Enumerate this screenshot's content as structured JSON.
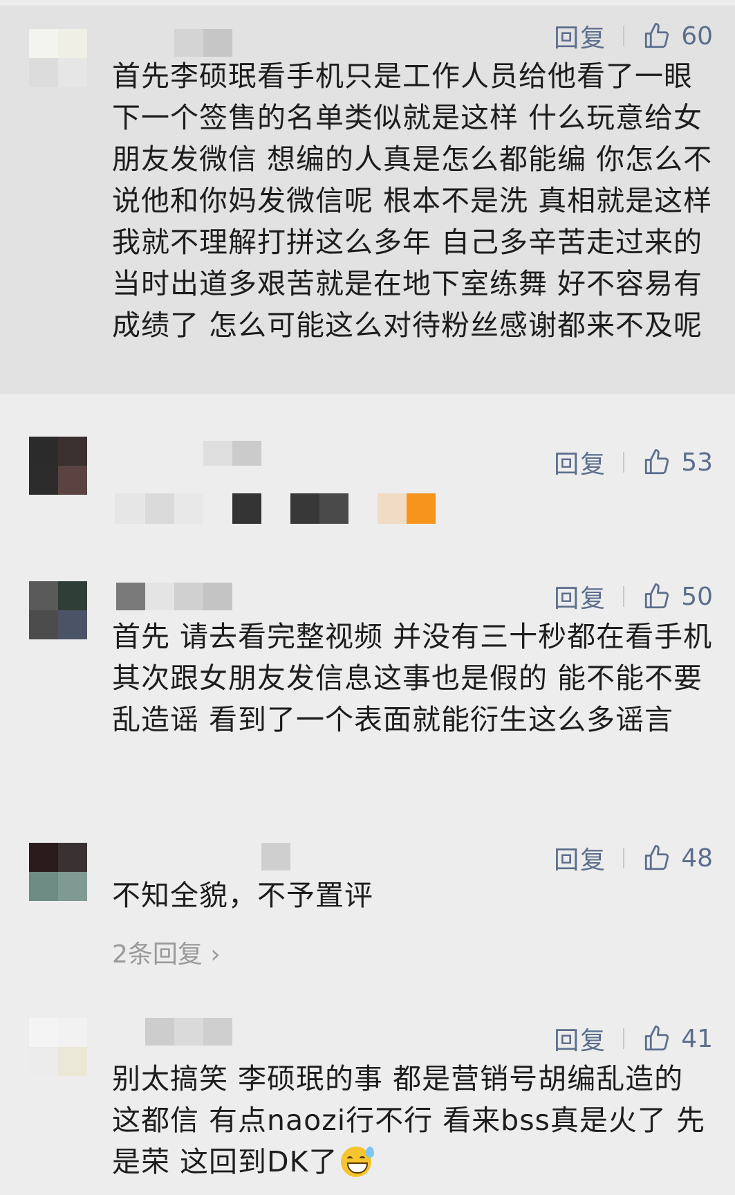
{
  "colors": {
    "background": "#ededed",
    "highlight": "#e2e2e2",
    "action": "#5b6e8c",
    "muted": "#9a9a9a"
  },
  "comments": [
    {
      "reply_label": "回复",
      "likes": "60",
      "text": "首先李硕珉看手机只是工作人员给他看了一眼下一个签售的名单类似就是这样 什么玩意给女朋友发微信 想编的人真是怎么都能编 你怎么不说他和你妈发微信呢 根本不是洗 真相就是这样 我就不理解打拼这么多年 自己多辛苦走过来的 当时出道多艰苦就是在地下室练舞 好不容易有成绩了 怎么可能这么对待粉丝感谢都来不及呢"
    },
    {
      "reply_label": "回复",
      "likes": "53"
    },
    {
      "reply_label": "回复",
      "likes": "50",
      "text": "首先 请去看完整视频 并没有三十秒都在看手机 其次跟女朋友发信息这事也是假的 能不能不要乱造谣 看到了一个表面就能衍生这么多谣言"
    },
    {
      "reply_label": "回复",
      "likes": "48",
      "text": "不知全貌，不予置评",
      "more_replies": "2条回复"
    },
    {
      "reply_label": "回复",
      "likes": "41",
      "text": "别太搞笑 李硕珉的事 都是营销号胡编乱造的 这都信 有点naozi行不行 看来bss真是火了 先是荣 这回到DK了",
      "emoji": "sweat-smile-emoji"
    }
  ]
}
